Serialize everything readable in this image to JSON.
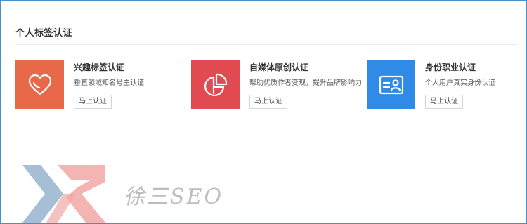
{
  "section": {
    "title": "个人标签认证"
  },
  "cards": [
    {
      "name": "兴趣标签认证",
      "desc": "垂直领域知名号主认证",
      "button": "马上认证",
      "icon": "heart-icon",
      "color": "#e8694a"
    },
    {
      "name": "自媒体原创认证",
      "desc": "帮助优质作者变现，提升品牌影响力",
      "button": "马上认证",
      "icon": "pie-chart-icon",
      "color": "#e14a51"
    },
    {
      "name": "身份职业认证",
      "desc": "个人用户真实身份认证",
      "button": "马上认证",
      "icon": "id-card-icon",
      "color": "#2f8ae8"
    }
  ],
  "watermark": {
    "text": "徐三SEO",
    "logo": "xr-logo"
  }
}
